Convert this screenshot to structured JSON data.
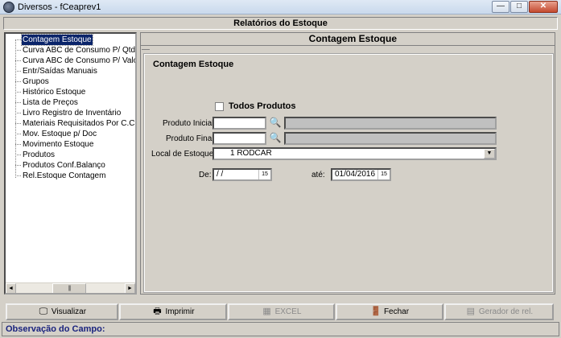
{
  "window": {
    "title": "Diversos - fCeaprev1",
    "min": "—",
    "max": "□",
    "close": "✕"
  },
  "header": {
    "title": "Relatórios do Estoque"
  },
  "tree": {
    "items": [
      {
        "label": "Contagem Estoque",
        "selected": true
      },
      {
        "label": "Curva ABC de Consumo P/ Qtde"
      },
      {
        "label": "Curva ABC de Consumo P/ Valor"
      },
      {
        "label": "Entr/Saídas Manuais"
      },
      {
        "label": "Grupos"
      },
      {
        "label": "Histórico Estoque"
      },
      {
        "label": "Lista de Preços"
      },
      {
        "label": "Livro Registro de Inventário"
      },
      {
        "label": "Materiais Requisitados Por C.Custo"
      },
      {
        "label": "Mov. Estoque p/ Doc"
      },
      {
        "label": "Movimento Estoque"
      },
      {
        "label": "Produtos"
      },
      {
        "label": "Produtos Conf.Balanço"
      },
      {
        "label": "Rel.Estoque Contagem"
      }
    ],
    "scroll_left": "◄",
    "scroll_right": "►",
    "scroll_thumb": "|||"
  },
  "content": {
    "title": "Contagem Estoque",
    "group_title": "Contagem Estoque",
    "todos_produtos": {
      "label": "Todos Produtos",
      "checked": false
    },
    "produto_inicial": {
      "label": "Produto Inicial:",
      "value": "",
      "description": ""
    },
    "produto_final": {
      "label": "Produto Final:",
      "value": "",
      "description": ""
    },
    "local_estoque": {
      "label": "Local de Estoque:",
      "value": "1  RODCAR",
      "arrow": "▼"
    },
    "de": {
      "label": "De:",
      "value": " / /"
    },
    "ate": {
      "label": "até:",
      "value": "01/04/2016"
    },
    "search_icon": "🔍",
    "calendar_icon": "15"
  },
  "buttons": {
    "visualizar": {
      "label": "Visualizar",
      "icon": "🖵"
    },
    "imprimir": {
      "label": "Imprimir",
      "icon": "🖶"
    },
    "excel": {
      "label": "EXCEL",
      "icon": "▦"
    },
    "fechar": {
      "label": "Fechar",
      "icon": "🚪"
    },
    "gerador": {
      "label": "Gerador de rel.",
      "icon": "▤"
    }
  },
  "observacao": {
    "label": "Observação do Campo:"
  },
  "colors": {
    "selection": "#0a246a",
    "window_bg": "#d4d0c8",
    "obs_label": "#1a237e"
  }
}
